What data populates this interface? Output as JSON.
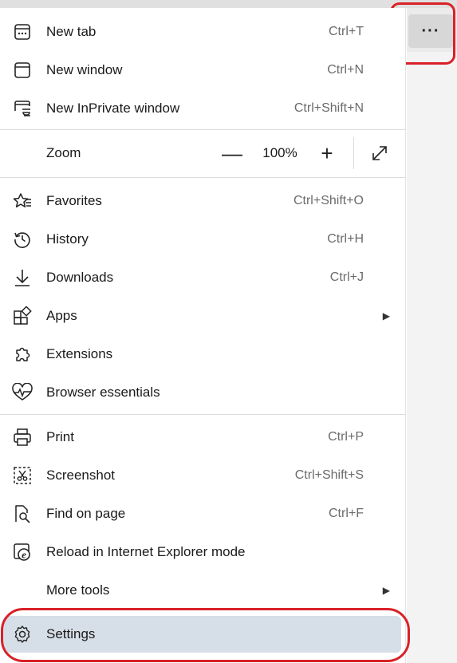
{
  "more_button": {
    "label": "···",
    "icon": "more-horizontal-icon"
  },
  "menu": {
    "group1": [
      {
        "label": "New tab",
        "shortcut": "Ctrl+T",
        "icon": "new-tab-icon"
      },
      {
        "label": "New window",
        "shortcut": "Ctrl+N",
        "icon": "new-window-icon"
      },
      {
        "label": "New InPrivate window",
        "shortcut": "Ctrl+Shift+N",
        "icon": "inprivate-window-icon"
      }
    ],
    "zoom": {
      "label": "Zoom",
      "minus": "—",
      "value": "100%",
      "plus": "+",
      "fullscreen_icon": "fullscreen-icon"
    },
    "group2": [
      {
        "label": "Favorites",
        "shortcut": "Ctrl+Shift+O",
        "icon": "favorites-icon"
      },
      {
        "label": "History",
        "shortcut": "Ctrl+H",
        "icon": "history-icon"
      },
      {
        "label": "Downloads",
        "shortcut": "Ctrl+J",
        "icon": "downloads-icon"
      },
      {
        "label": "Apps",
        "shortcut": "",
        "icon": "apps-icon",
        "submenu": true
      },
      {
        "label": "Extensions",
        "shortcut": "",
        "icon": "extensions-icon"
      },
      {
        "label": "Browser essentials",
        "shortcut": "",
        "icon": "heart-pulse-icon"
      }
    ],
    "group3": [
      {
        "label": "Print",
        "shortcut": "Ctrl+P",
        "icon": "print-icon"
      },
      {
        "label": "Screenshot",
        "shortcut": "Ctrl+Shift+S",
        "icon": "screenshot-icon"
      },
      {
        "label": "Find on page",
        "shortcut": "Ctrl+F",
        "icon": "find-icon"
      },
      {
        "label": "Reload in Internet Explorer mode",
        "shortcut": "",
        "icon": "ie-mode-icon"
      },
      {
        "label": "More tools",
        "shortcut": "",
        "icon": "",
        "submenu": true
      }
    ],
    "settings": {
      "label": "Settings",
      "icon": "gear-icon"
    },
    "submenu_arrow": "▶"
  },
  "colors": {
    "highlight_red": "#d92027",
    "settings_bg": "#d6dee7",
    "shortcut_gray": "#6b6b6b"
  }
}
